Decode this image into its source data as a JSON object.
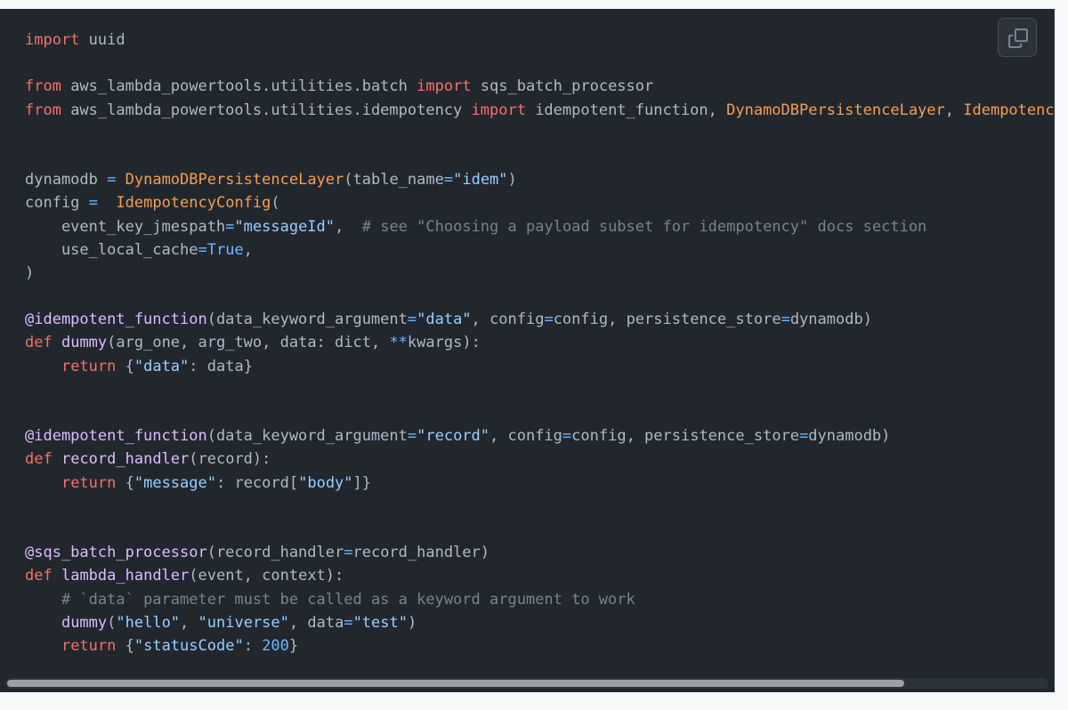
{
  "code": {
    "language": "python",
    "lines": [
      [
        [
          "kw",
          "import"
        ],
        [
          "pl",
          " uuid"
        ]
      ],
      [],
      [
        [
          "kw",
          "from"
        ],
        [
          "pl",
          " aws_lambda_powertools.utilities.batch "
        ],
        [
          "kw",
          "import"
        ],
        [
          "pl",
          " sqs_batch_processor"
        ]
      ],
      [
        [
          "kw",
          "from"
        ],
        [
          "pl",
          " aws_lambda_powertools.utilities.idempotency "
        ],
        [
          "kw",
          "import"
        ],
        [
          "pl",
          " idempotent_function, "
        ],
        [
          "cls",
          "DynamoDBPersistenceLayer"
        ],
        [
          "pl",
          ", "
        ],
        [
          "cls",
          "IdempotencyConfig"
        ]
      ],
      [],
      [],
      [
        [
          "pl",
          "dynamodb "
        ],
        [
          "op",
          "="
        ],
        [
          "pl",
          " "
        ],
        [
          "cls",
          "DynamoDBPersistenceLayer"
        ],
        [
          "pl",
          "(table_name"
        ],
        [
          "op",
          "="
        ],
        [
          "str",
          "\"idem\""
        ],
        [
          "pl",
          ")"
        ]
      ],
      [
        [
          "pl",
          "config "
        ],
        [
          "op",
          "="
        ],
        [
          "pl",
          "  "
        ],
        [
          "cls",
          "IdempotencyConfig"
        ],
        [
          "pl",
          "("
        ]
      ],
      [
        [
          "pl",
          "    event_key_jmespath"
        ],
        [
          "op",
          "="
        ],
        [
          "str",
          "\"messageId\""
        ],
        [
          "pl",
          ",  "
        ],
        [
          "cmt",
          "# see \"Choosing a payload subset for idempotency\" docs section"
        ]
      ],
      [
        [
          "pl",
          "    use_local_cache"
        ],
        [
          "op",
          "="
        ],
        [
          "num",
          "True"
        ],
        [
          "pl",
          ","
        ]
      ],
      [
        [
          "pl",
          ")"
        ]
      ],
      [],
      [
        [
          "fn",
          "@idempotent_function"
        ],
        [
          "pl",
          "(data_keyword_argument"
        ],
        [
          "op",
          "="
        ],
        [
          "str",
          "\"data\""
        ],
        [
          "pl",
          ", config"
        ],
        [
          "op",
          "="
        ],
        [
          "pl",
          "config, persistence_store"
        ],
        [
          "op",
          "="
        ],
        [
          "pl",
          "dynamodb)"
        ]
      ],
      [
        [
          "kw",
          "def"
        ],
        [
          "pl",
          " "
        ],
        [
          "fn",
          "dummy"
        ],
        [
          "pl",
          "(arg_one, arg_two, data: dict, "
        ],
        [
          "op",
          "**"
        ],
        [
          "pl",
          "kwargs):"
        ]
      ],
      [
        [
          "pl",
          "    "
        ],
        [
          "kw",
          "return"
        ],
        [
          "pl",
          " {"
        ],
        [
          "str",
          "\"data\""
        ],
        [
          "pl",
          ": data}"
        ]
      ],
      [],
      [],
      [
        [
          "fn",
          "@idempotent_function"
        ],
        [
          "pl",
          "(data_keyword_argument"
        ],
        [
          "op",
          "="
        ],
        [
          "str",
          "\"record\""
        ],
        [
          "pl",
          ", config"
        ],
        [
          "op",
          "="
        ],
        [
          "pl",
          "config, persistence_store"
        ],
        [
          "op",
          "="
        ],
        [
          "pl",
          "dynamodb)"
        ]
      ],
      [
        [
          "kw",
          "def"
        ],
        [
          "pl",
          " "
        ],
        [
          "fn",
          "record_handler"
        ],
        [
          "pl",
          "(record):"
        ]
      ],
      [
        [
          "pl",
          "    "
        ],
        [
          "kw",
          "return"
        ],
        [
          "pl",
          " {"
        ],
        [
          "str",
          "\"message\""
        ],
        [
          "pl",
          ": record["
        ],
        [
          "str",
          "\"body\""
        ],
        [
          "pl",
          "]}"
        ]
      ],
      [],
      [],
      [
        [
          "fn",
          "@sqs_batch_processor"
        ],
        [
          "pl",
          "(record_handler"
        ],
        [
          "op",
          "="
        ],
        [
          "pl",
          "record_handler)"
        ]
      ],
      [
        [
          "kw",
          "def"
        ],
        [
          "pl",
          " "
        ],
        [
          "fn",
          "lambda_handler"
        ],
        [
          "pl",
          "(event, context):"
        ]
      ],
      [
        [
          "pl",
          "    "
        ],
        [
          "cmt",
          "# `data` parameter must be called as a keyword argument to work"
        ]
      ],
      [
        [
          "pl",
          "    "
        ],
        [
          "fn",
          "dummy"
        ],
        [
          "pl",
          "("
        ],
        [
          "str",
          "\"hello\""
        ],
        [
          "pl",
          ", "
        ],
        [
          "str",
          "\"universe\""
        ],
        [
          "pl",
          ", data"
        ],
        [
          "op",
          "="
        ],
        [
          "str",
          "\"test\""
        ],
        [
          "pl",
          ")"
        ]
      ],
      [
        [
          "pl",
          "    "
        ],
        [
          "kw",
          "return"
        ],
        [
          "pl",
          " {"
        ],
        [
          "str",
          "\"statusCode\""
        ],
        [
          "pl",
          ": "
        ],
        [
          "num",
          "200"
        ],
        [
          "pl",
          "}"
        ]
      ]
    ]
  },
  "toolbar": {
    "copy_icon": "copy-icon"
  },
  "scrollbar": {
    "scroll_fraction": 0
  }
}
